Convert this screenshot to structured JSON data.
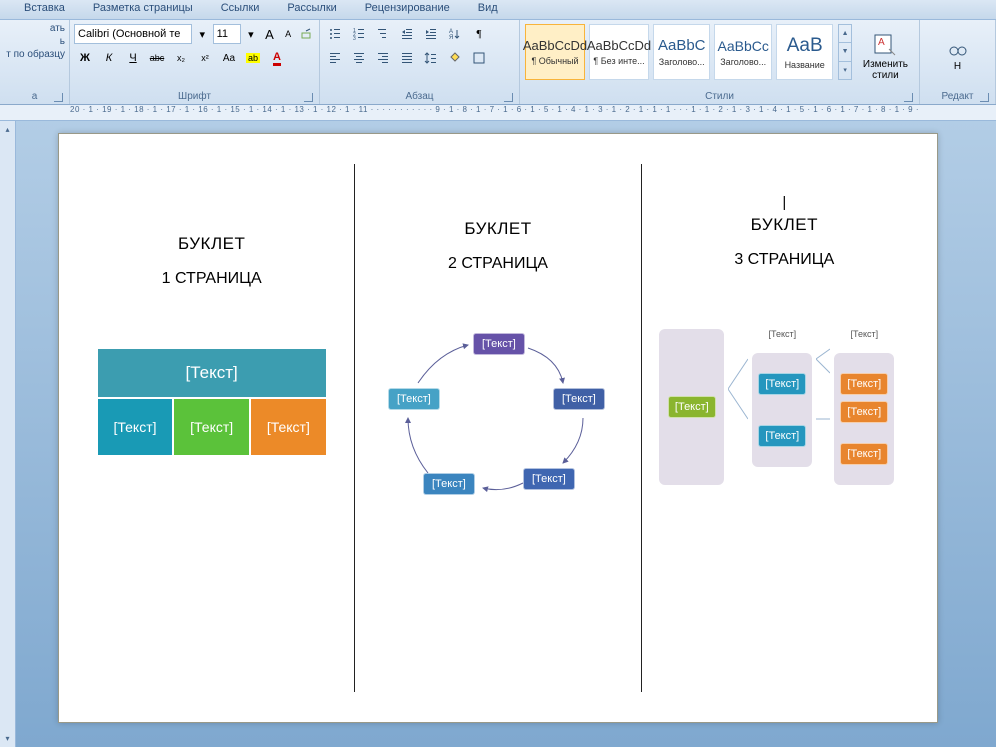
{
  "tabs": [
    "Вставка",
    "Разметка страницы",
    "Ссылки",
    "Рассылки",
    "Рецензирование",
    "Вид"
  ],
  "clipboard": {
    "paste_top": "ать",
    "paste_bottom": "ь",
    "format_painter": "т по образцу",
    "label": "а"
  },
  "font": {
    "family": "Calibri (Основной те",
    "size": "11",
    "label": "Шрифт",
    "btn_bold": "Ж",
    "btn_italic": "К",
    "btn_underline": "Ч",
    "btn_strike": "abc",
    "btn_sub": "x₂",
    "btn_sup": "x²",
    "btn_case": "Aa",
    "btn_grow": "A",
    "btn_shrink": "A",
    "btn_clear": "⌫",
    "btn_highlight": "ab",
    "btn_color": "A"
  },
  "para": {
    "label": "Абзац"
  },
  "styles": {
    "label": "Стили",
    "items": [
      {
        "preview": "AaBbCcDd",
        "name": "¶ Обычный",
        "sel": true
      },
      {
        "preview": "AaBbCcDd",
        "name": "¶ Без инте..."
      },
      {
        "preview": "AaBbC",
        "name": "Заголово...",
        "blue": true
      },
      {
        "preview": "AaBbCc",
        "name": "Заголово...",
        "blue": true
      },
      {
        "preview": "AaB",
        "name": "Название",
        "blue": true
      }
    ],
    "change": "Изменить\nстили"
  },
  "editing": {
    "find_top": "Н",
    "label": "Редакт"
  },
  "ruler": "20 · 1 · 19 · 1 · 18 · 1 · 17 · 1 · 16 · 1 · 15 · 1 · 14 · 1 · 13 · 1 · 12 · 1 · 11 · · · · · · · · · · · 9 · 1 · 8 · 1 · 7 · 1 · 6 · 1 · 5 · 1 · 4 · 1 · 3 · 1 · 2 · 1 · 1 · 1 · · · 1 · 1 · 2 · 1 · 3 · 1 · 4 · 1 · 5 · 1 · 6 · 1 · 7 · 1 · 8 · 1 · 9 ·",
  "doc": {
    "p1": {
      "title": "БУКЛЕТ",
      "sub": "1 СТРАНИЦА"
    },
    "p2": {
      "title": "БУКЛЕТ",
      "sub": "2 СТРАНИЦА"
    },
    "p3": {
      "pre": "|",
      "title": "БУКЛЕТ",
      "sub": "3 СТРАНИЦА"
    },
    "ph": "[Текст]"
  }
}
